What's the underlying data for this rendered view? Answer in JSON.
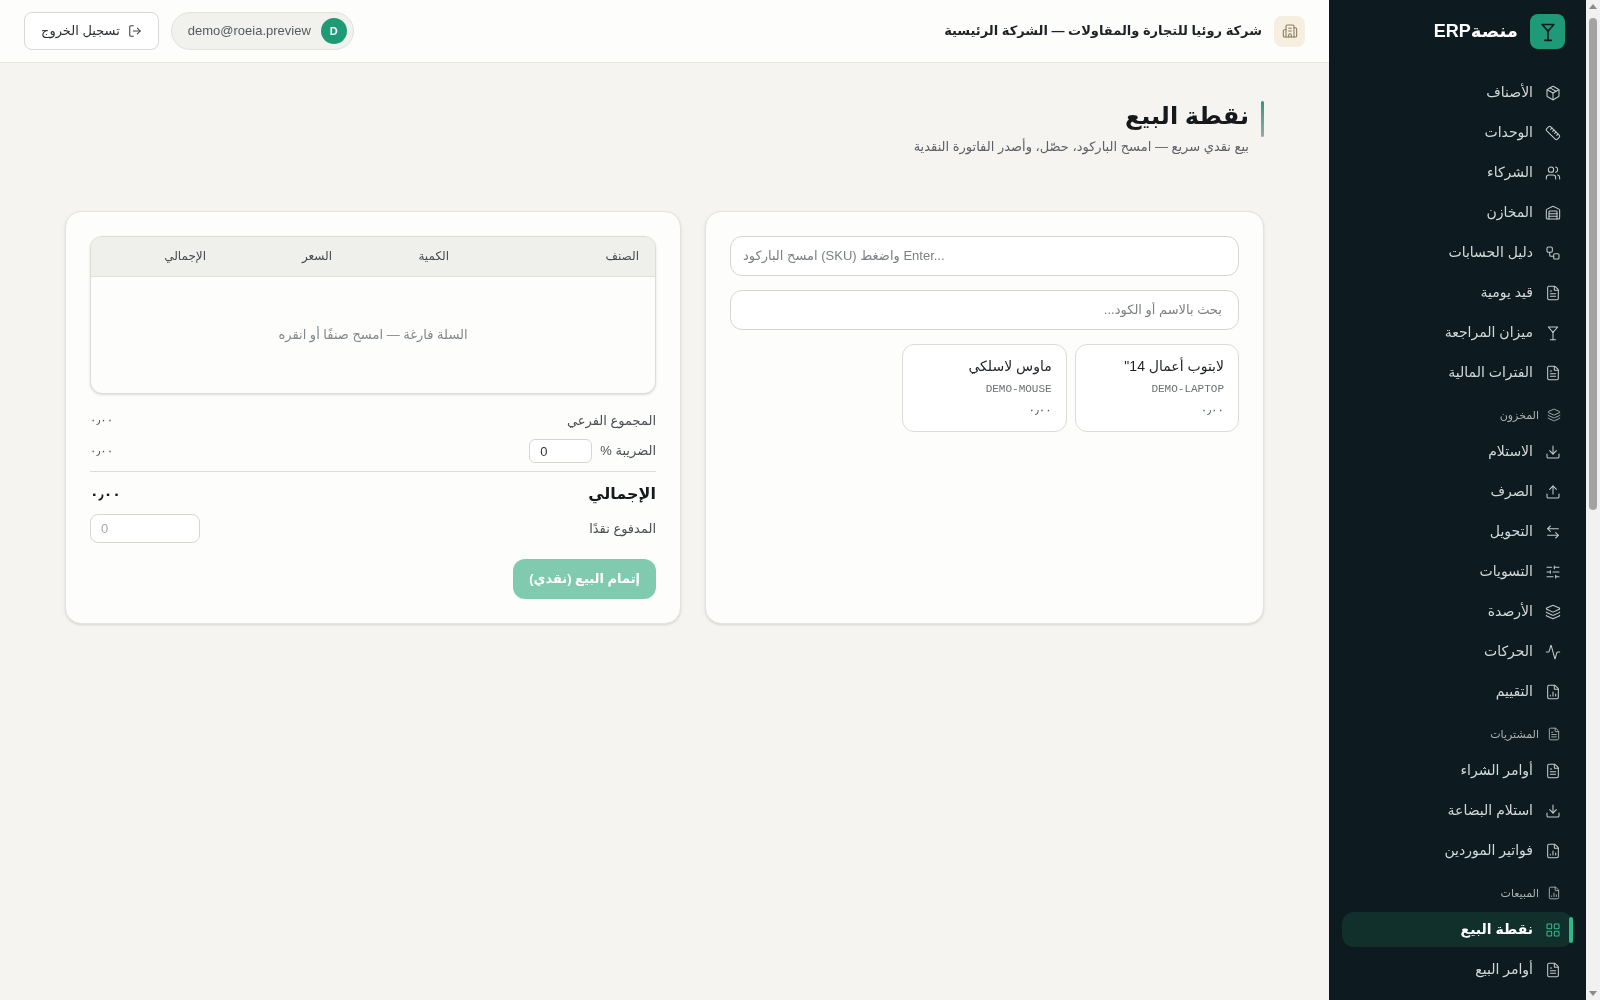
{
  "header": {
    "company": "شركة روئيا للتجارة والمقاولات — الشركة الرئيسية",
    "user": {
      "initial": "D",
      "email": "demo@roeia.preview"
    },
    "logout": "تسجيل الخروج"
  },
  "sidebar": {
    "brand": "منصةERP",
    "items": [
      {
        "label": "الأصناف",
        "selected": false
      },
      {
        "label": "الوحدات",
        "selected": false
      },
      {
        "label": "الشركاء",
        "selected": false
      },
      {
        "label": "المخازن",
        "selected": false
      },
      {
        "label": "دليل الحسابات",
        "selected": false
      },
      {
        "label": "قيد يومية",
        "selected": false
      },
      {
        "label": "ميزان المراجعة",
        "selected": false
      },
      {
        "label": "الفترات المالية",
        "selected": false
      }
    ],
    "sections": [
      {
        "title": "المخزون",
        "items": [
          {
            "label": "الاستلام",
            "selected": false
          },
          {
            "label": "الصرف",
            "selected": false
          },
          {
            "label": "التحويل",
            "selected": false
          },
          {
            "label": "التسويات",
            "selected": false
          },
          {
            "label": "الأرصدة",
            "selected": false
          },
          {
            "label": "الحركات",
            "selected": false
          },
          {
            "label": "التقييم",
            "selected": false
          }
        ]
      },
      {
        "title": "المشتريات",
        "items": [
          {
            "label": "أوامر الشراء",
            "selected": false
          },
          {
            "label": "استلام البضاعة",
            "selected": false
          },
          {
            "label": "فواتير الموردين",
            "selected": false
          }
        ]
      },
      {
        "title": "المبيعات",
        "items": [
          {
            "label": "نقطة البيع",
            "selected": true
          },
          {
            "label": "أوامر البيع",
            "selected": false
          }
        ]
      }
    ]
  },
  "page": {
    "title": "نقطة البيع",
    "subtitle": "بيع نقدي سريع — امسح الباركود، حصّل، وأصدر الفاتورة النقدية"
  },
  "catalog": {
    "barcode": {
      "placeholder": "امسح الباركود (SKU) واضغط Enter..."
    },
    "search": {
      "placeholder": "بحث بالاسم أو الكود..."
    },
    "products": [
      {
        "name": "لابتوب أعمال 14\"",
        "sku": "DEMO-LAPTOP",
        "price": "٠٫٠٠"
      },
      {
        "name": "ماوس لاسلكي",
        "sku": "DEMO-MOUSE",
        "price": "٠٫٠٠"
      }
    ]
  },
  "cart": {
    "columns": [
      "الصنف",
      "الكمية",
      "السعر",
      "الإجمالي"
    ],
    "empty_message": "السلة فارغة — امسح صنفًا أو انقره",
    "subtotal": {
      "label": "المجموع الفرعي",
      "value": "٠٫٠٠"
    },
    "tax": {
      "label": "الضريبة %",
      "rate": "0",
      "value": "٠٫٠٠"
    },
    "total": {
      "label": "الإجمالي",
      "value": "٠٫٠٠"
    },
    "paid": {
      "label": "المدفوع نقدًا",
      "placeholder": "0"
    },
    "submit": {
      "label": "إتمام البيع (نقدي)",
      "disabled": true
    }
  }
}
